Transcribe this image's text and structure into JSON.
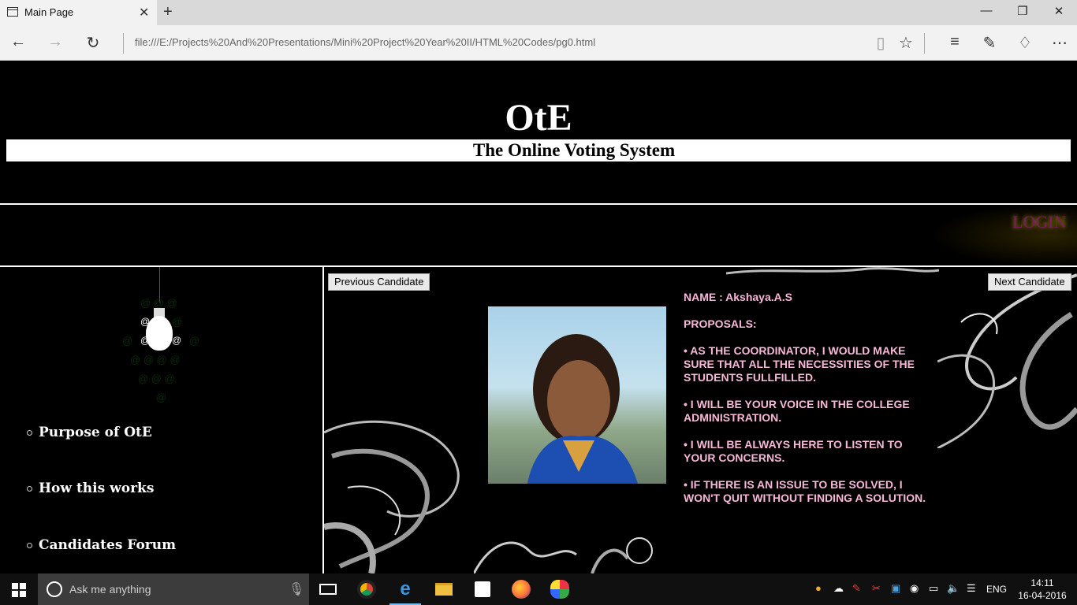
{
  "browser": {
    "tab_title": "Main Page",
    "address": "file:///E:/Projects%20And%20Presentations/Mini%20Project%20Year%20II/HTML%20Codes/pg0.html"
  },
  "site": {
    "title": "OtE",
    "subtitle": "The Online Voting System",
    "login_label": "LOGIN"
  },
  "sidebar": {
    "items": [
      {
        "label": "Purpose of OtE"
      },
      {
        "label": "How this works"
      },
      {
        "label": "Candidates Forum"
      }
    ]
  },
  "candidate": {
    "prev_label": "Previous Candidate",
    "next_label": "Next Candidate",
    "name": "NAME : Akshaya.A.S",
    "proposals_heading": "PROPOSALS:",
    "proposals": [
      "•  AS THE COORDINATOR, I WOULD MAKE SURE THAT ALL THE NECESSITIES OF THE STUDENTS FULLFILLED.",
      "•  I WILL BE YOUR VOICE IN THE COLLEGE ADMINISTRATION.",
      "•  I WILL BE ALWAYS HERE TO LISTEN TO YOUR CONCERNS.",
      "•  IF THERE IS AN ISSUE TO BE SOLVED, I WON'T QUIT WITHOUT FINDING A SOLUTION."
    ]
  },
  "taskbar": {
    "search_placeholder": "Ask me anything",
    "language": "ENG",
    "time": "14:11",
    "date": "16-04-2016"
  },
  "colors": {
    "proposal_text": "#f7b8d8",
    "login_text": "#7a1a6a",
    "taskbar_accent": "#76b9ed"
  }
}
